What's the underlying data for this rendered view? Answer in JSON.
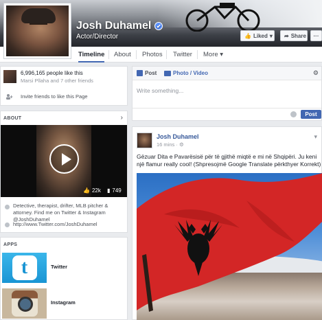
{
  "profile": {
    "name": "Josh Duhamel",
    "category": "Actor/Director",
    "verified_icon": "verified-check-icon"
  },
  "header_actions": {
    "liked_label": "Liked",
    "share_label": "Share"
  },
  "nav": {
    "tabs": [
      {
        "label": "Timeline",
        "active": true
      },
      {
        "label": "About"
      },
      {
        "label": "Photos"
      },
      {
        "label": "Twitter"
      },
      {
        "label": "More"
      }
    ]
  },
  "likes": {
    "count_text": "6,996,165 people like this",
    "friends_text": "Marsi Pllaha and 7 other friends",
    "invite_text": "Invite friends to like this Page"
  },
  "about": {
    "title": "ABOUT",
    "video_likes": "22k",
    "video_comments": "749",
    "bio": "Detective, therapist, drifter, MLB pitcher & attorney. Find me on Twitter & Instagram @JoshDuhamel",
    "link": "http://www.Twitter.com/JoshDuhamel"
  },
  "apps": {
    "title": "APPS",
    "items": [
      {
        "label": "Twitter"
      },
      {
        "label": "Instagram"
      }
    ]
  },
  "composer": {
    "tab_post": "Post",
    "tab_photo": "Photo / Video",
    "placeholder": "Write something...",
    "post_button": "Post"
  },
  "post": {
    "author": "Josh Duhamel",
    "time": "16 mins",
    "text": "Gëzuar Dita e Pavarësisë për të gjithë miqtë e mi në Shqipëri. Ju keni një flamur really cool! (Shpresojmë Google Translate përkthyer Korrekt)"
  },
  "colors": {
    "facebook_blue": "#4267b2",
    "link_blue": "#365899",
    "albanian_red": "#d32626"
  }
}
